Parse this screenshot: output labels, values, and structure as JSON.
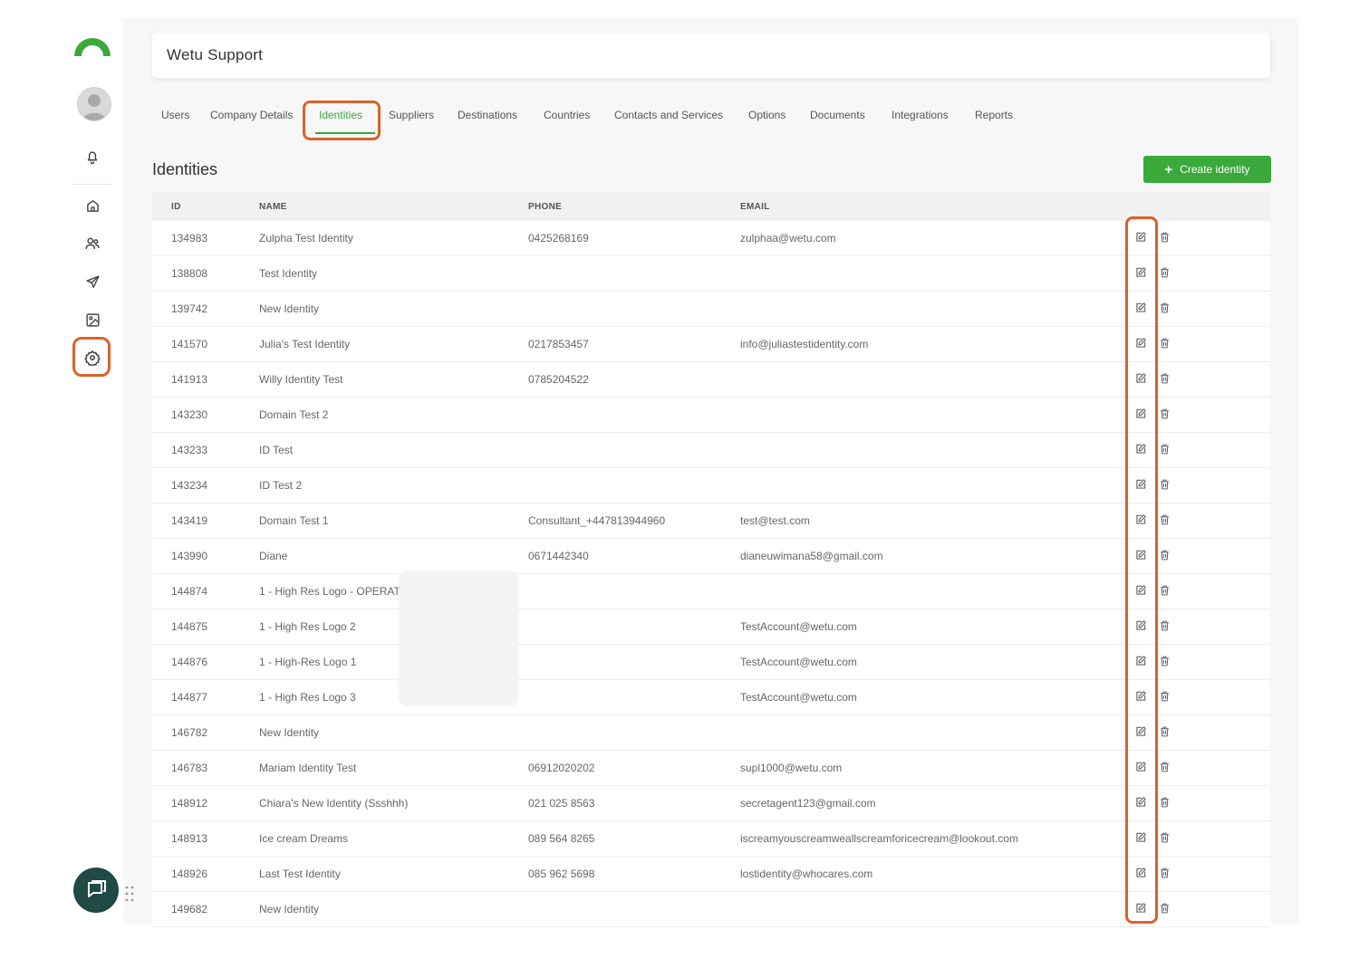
{
  "header": {
    "title": "Wetu Support"
  },
  "tabs": [
    {
      "label": "Users"
    },
    {
      "label": "Company Details"
    },
    {
      "label": "Identities",
      "active": true
    },
    {
      "label": "Suppliers"
    },
    {
      "label": "Destinations"
    },
    {
      "label": "Countries"
    },
    {
      "label": "Contacts and Services"
    },
    {
      "label": "Options"
    },
    {
      "label": "Documents"
    },
    {
      "label": "Integrations"
    },
    {
      "label": "Reports"
    }
  ],
  "section": {
    "title": "Identities",
    "create_label": "Create identity"
  },
  "table": {
    "columns": [
      "ID",
      "NAME",
      "PHONE",
      "EMAIL"
    ],
    "rows": [
      {
        "id": "134983",
        "name": "Zulpha Test Identity",
        "phone": "0425268169",
        "email": "zulphaa@wetu.com"
      },
      {
        "id": "138808",
        "name": "Test Identity",
        "phone": "",
        "email": ""
      },
      {
        "id": "139742",
        "name": "New Identity",
        "phone": "",
        "email": ""
      },
      {
        "id": "141570",
        "name": "Julia's Test Identity",
        "phone": "0217853457",
        "email": "info@juliastestidentity.com"
      },
      {
        "id": "141913",
        "name": "Willy Identity Test",
        "phone": "0785204522",
        "email": ""
      },
      {
        "id": "143230",
        "name": "Domain Test 2",
        "phone": "",
        "email": ""
      },
      {
        "id": "143233",
        "name": "ID Test",
        "phone": "",
        "email": ""
      },
      {
        "id": "143234",
        "name": "ID Test 2",
        "phone": "",
        "email": ""
      },
      {
        "id": "143419",
        "name": "Domain Test 1",
        "phone": "Consultant_+447813944960",
        "email": "test@test.com"
      },
      {
        "id": "143990",
        "name": "Diane",
        "phone": "0671442340",
        "email": "dianeuwimana58@gmail.com"
      },
      {
        "id": "144874",
        "name": "1 - High Res Logo - OPERATOR LOGO",
        "phone": "",
        "email": ""
      },
      {
        "id": "144875",
        "name": "1 - High Res Logo 2",
        "phone": "",
        "email": "TestAccount@wetu.com"
      },
      {
        "id": "144876",
        "name": "1 - High-Res Logo 1",
        "phone": "",
        "email": "TestAccount@wetu.com"
      },
      {
        "id": "144877",
        "name": "1 - High Res Logo 3",
        "phone": "",
        "email": "TestAccount@wetu.com"
      },
      {
        "id": "146782",
        "name": "New Identity",
        "phone": "",
        "email": ""
      },
      {
        "id": "146783",
        "name": "Mariam Identity Test",
        "phone": "06912020202",
        "email": "supl1000@wetu.com"
      },
      {
        "id": "148912",
        "name": "Chiara's New Identity (Ssshhh)",
        "phone": "021 025 8563",
        "email": "secretagent123@gmail.com"
      },
      {
        "id": "148913",
        "name": "Ice cream Dreams",
        "phone": "089 564 8265",
        "email": "iscreamyouscreamweallscreamforicecream@lookout.com"
      },
      {
        "id": "148926",
        "name": "Last Test Identity",
        "phone": "085 962 5698",
        "email": "lostidentity@whocares.com"
      },
      {
        "id": "149682",
        "name": "New Identity",
        "phone": "",
        "email": ""
      }
    ]
  },
  "colors": {
    "accent": "#39a935",
    "highlight": "#d9622b",
    "chat": "#1f4a45"
  },
  "icons": {
    "sidebar": [
      "bell-icon",
      "home-icon",
      "users-icon",
      "send-icon",
      "image-icon",
      "gear-icon"
    ],
    "row_actions": [
      "edit-icon",
      "trash-icon"
    ]
  }
}
